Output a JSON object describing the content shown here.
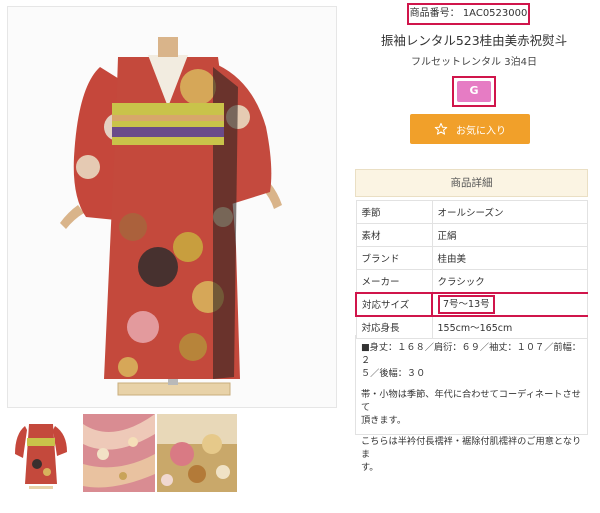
{
  "product": {
    "code_label": "商品番号：",
    "code_value": "1AC0523000",
    "title": "振袖レンタル523桂由美赤祝熨斗",
    "subtitle": "フルセットレンタル  3泊4日",
    "size_badge": "G",
    "fav_label": "お気に入り"
  },
  "details": {
    "header": "商品詳細",
    "rows": [
      {
        "key": "季節",
        "value": "オールシーズン"
      },
      {
        "key": "素材",
        "value": "正絹"
      },
      {
        "key": "ブランド",
        "value": "桂由美"
      },
      {
        "key": "メーカー",
        "value": "クラシック"
      },
      {
        "key": "対応サイズ",
        "value": "7号～13号"
      },
      {
        "key": "対応身長",
        "value": "155cm～165cm"
      }
    ],
    "measure_line1": "■身丈：１６８／肩衍：６９／袖丈：１０７／前幅：２",
    "measure_line2": "５／後幅：３０",
    "note1_line1": "帯・小物は季節、年代に合わせてコーディネートさせて",
    "note1_line2": "頂きます。",
    "note2_line1": "こちらは半衿付長襦袢・裾除付肌襦袢のご用意となりま",
    "note2_line2": "す。"
  },
  "colors": {
    "accent_red": "#d0154b",
    "fav_orange": "#f1a02a",
    "badge_pink": "#e67cc4",
    "header_bg": "#fbf4e3"
  },
  "icons": {
    "fav": "star-outline-icon"
  }
}
